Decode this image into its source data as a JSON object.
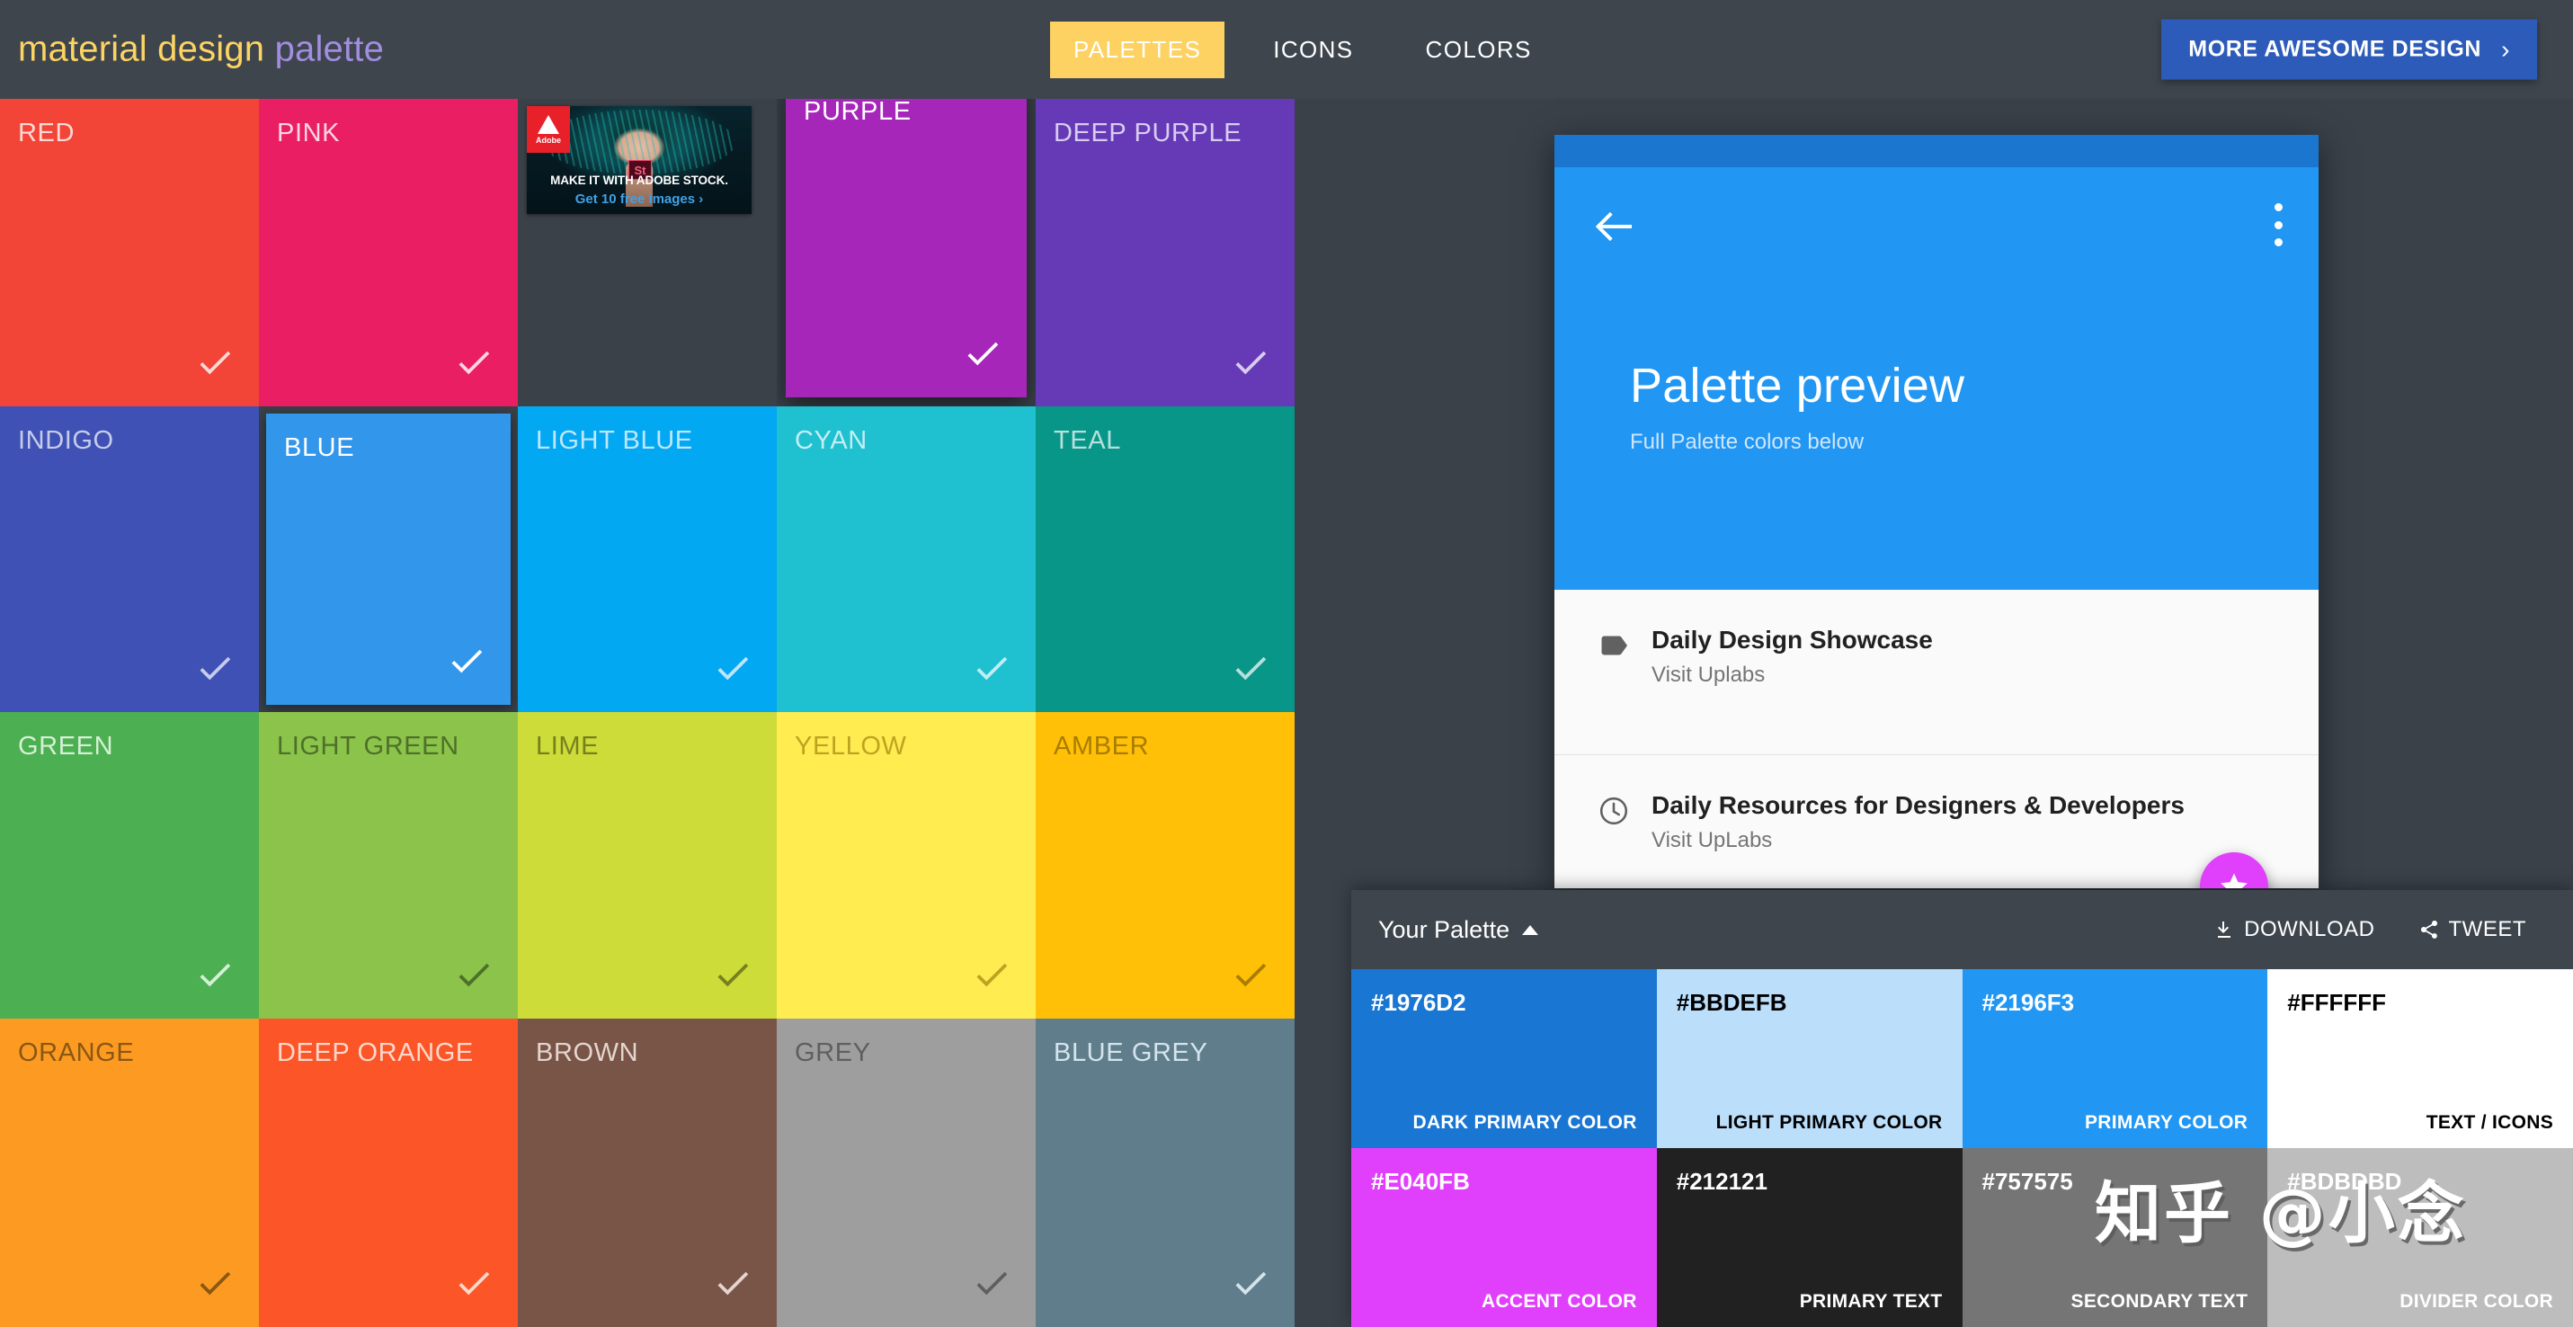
{
  "header": {
    "logo_part1": "material design",
    "logo_part2": "palette",
    "nav": [
      {
        "label": "PALETTES",
        "active": true
      },
      {
        "label": "ICONS",
        "active": false
      },
      {
        "label": "COLORS",
        "active": false
      }
    ],
    "cta_label": "MORE AWESOME DESIGN",
    "cta_chevron": "›",
    "bg": "#3e454d",
    "accent": "#fdd262",
    "cta_bg": "#2d5bb9"
  },
  "grid": {
    "tiles": [
      {
        "name": "RED",
        "bg": "#f24437",
        "text": "#ffd9d5",
        "state": "normal"
      },
      {
        "name": "PINK",
        "bg": "#e91e63",
        "text": "#ffd5e3",
        "state": "normal"
      },
      {
        "name": "",
        "bg": "#3a4149",
        "text": "#ffffff",
        "state": "ad"
      },
      {
        "name": "PURPLE",
        "bg": "#a626ba",
        "text": "#ffffff",
        "state": "elevated"
      },
      {
        "name": "DEEP PURPLE",
        "bg": "#6639b6",
        "text": "#d8cdf0",
        "state": "normal"
      },
      {
        "name": "INDIGO",
        "bg": "#3f51b4",
        "text": "#c6ccec",
        "state": "normal"
      },
      {
        "name": "BLUE",
        "bg": "#3296eb",
        "text": "#ffffff",
        "state": "selected"
      },
      {
        "name": "LIGHT BLUE",
        "bg": "#03a8f3",
        "text": "#bfe6fb",
        "state": "normal"
      },
      {
        "name": "CYAN",
        "bg": "#1fc0d0",
        "text": "#c2eef3",
        "state": "normal"
      },
      {
        "name": "TEAL",
        "bg": "#089688",
        "text": "#b5e0db",
        "state": "normal"
      },
      {
        "name": "GREEN",
        "bg": "#4caf51",
        "text": "#d4f0d5",
        "state": "normal"
      },
      {
        "name": "LIGHT GREEN",
        "bg": "#8bc34b",
        "text": "#4e7029",
        "state": "normal"
      },
      {
        "name": "LIME",
        "bg": "#cddc38",
        "text": "#76801f",
        "state": "normal"
      },
      {
        "name": "YELLOW",
        "bg": "#ffec51",
        "text": "#bda420",
        "state": "normal"
      },
      {
        "name": "AMBER",
        "bg": "#ffc007",
        "text": "#a87d00",
        "state": "normal"
      },
      {
        "name": "ORANGE",
        "bg": "#fd9a22",
        "text": "#8a5712",
        "state": "normal"
      },
      {
        "name": "DEEP ORANGE",
        "bg": "#fc5528",
        "text": "#ffd9cb",
        "state": "normal"
      },
      {
        "name": "BROWN",
        "bg": "#795548",
        "text": "#e4d5cf",
        "state": "normal"
      },
      {
        "name": "GREY",
        "bg": "#9e9e9e",
        "text": "#5f5f5f",
        "state": "normal"
      },
      {
        "name": "BLUE GREY",
        "bg": "#607d8b",
        "text": "#d4e4ec",
        "state": "normal"
      }
    ]
  },
  "ad": {
    "brand": "Adobe",
    "product_badge": "St",
    "headline": "MAKE IT WITH ADOBE STOCK.",
    "cta": "Get 10 free images ›"
  },
  "preview": {
    "title": "Palette preview",
    "subtitle": "Full Palette colors below",
    "appbar_color": "#2196f3",
    "statusbar_color": "#1b76d0",
    "fab_color": "#e040fb",
    "rows": [
      {
        "icon": "label-icon",
        "title": "Daily Design Showcase",
        "subtitle": "Visit Uplabs"
      },
      {
        "icon": "clock-icon",
        "title": "Daily Resources for Designers & Developers",
        "subtitle": "Visit UpLabs"
      }
    ]
  },
  "palette_panel": {
    "title": "Your Palette",
    "download_label": "DOWNLOAD",
    "tweet_label": "TWEET",
    "swatches": [
      {
        "hex": "#1976D2",
        "label": "DARK PRIMARY COLOR",
        "bg": "#1976d2",
        "fg": "#ffffff"
      },
      {
        "hex": "#BBDEFB",
        "label": "LIGHT PRIMARY COLOR",
        "bg": "#bbdefb",
        "fg": "#000000"
      },
      {
        "hex": "#2196F3",
        "label": "PRIMARY COLOR",
        "bg": "#2196f3",
        "fg": "#ffffff"
      },
      {
        "hex": "#FFFFFF",
        "label": "TEXT / ICONS",
        "bg": "#ffffff",
        "fg": "#000000"
      },
      {
        "hex": "#E040FB",
        "label": "ACCENT COLOR",
        "bg": "#e040fb",
        "fg": "#ffffff"
      },
      {
        "hex": "#212121",
        "label": "PRIMARY TEXT",
        "bg": "#212121",
        "fg": "#ffffff"
      },
      {
        "hex": "#757575",
        "label": "SECONDARY TEXT",
        "bg": "#757575",
        "fg": "#ffffff"
      },
      {
        "hex": "#BDBDBD",
        "label": "DIVIDER COLOR",
        "bg": "#bdbdbd",
        "fg": "#ffffff"
      }
    ]
  },
  "watermark": "知乎 @小念"
}
